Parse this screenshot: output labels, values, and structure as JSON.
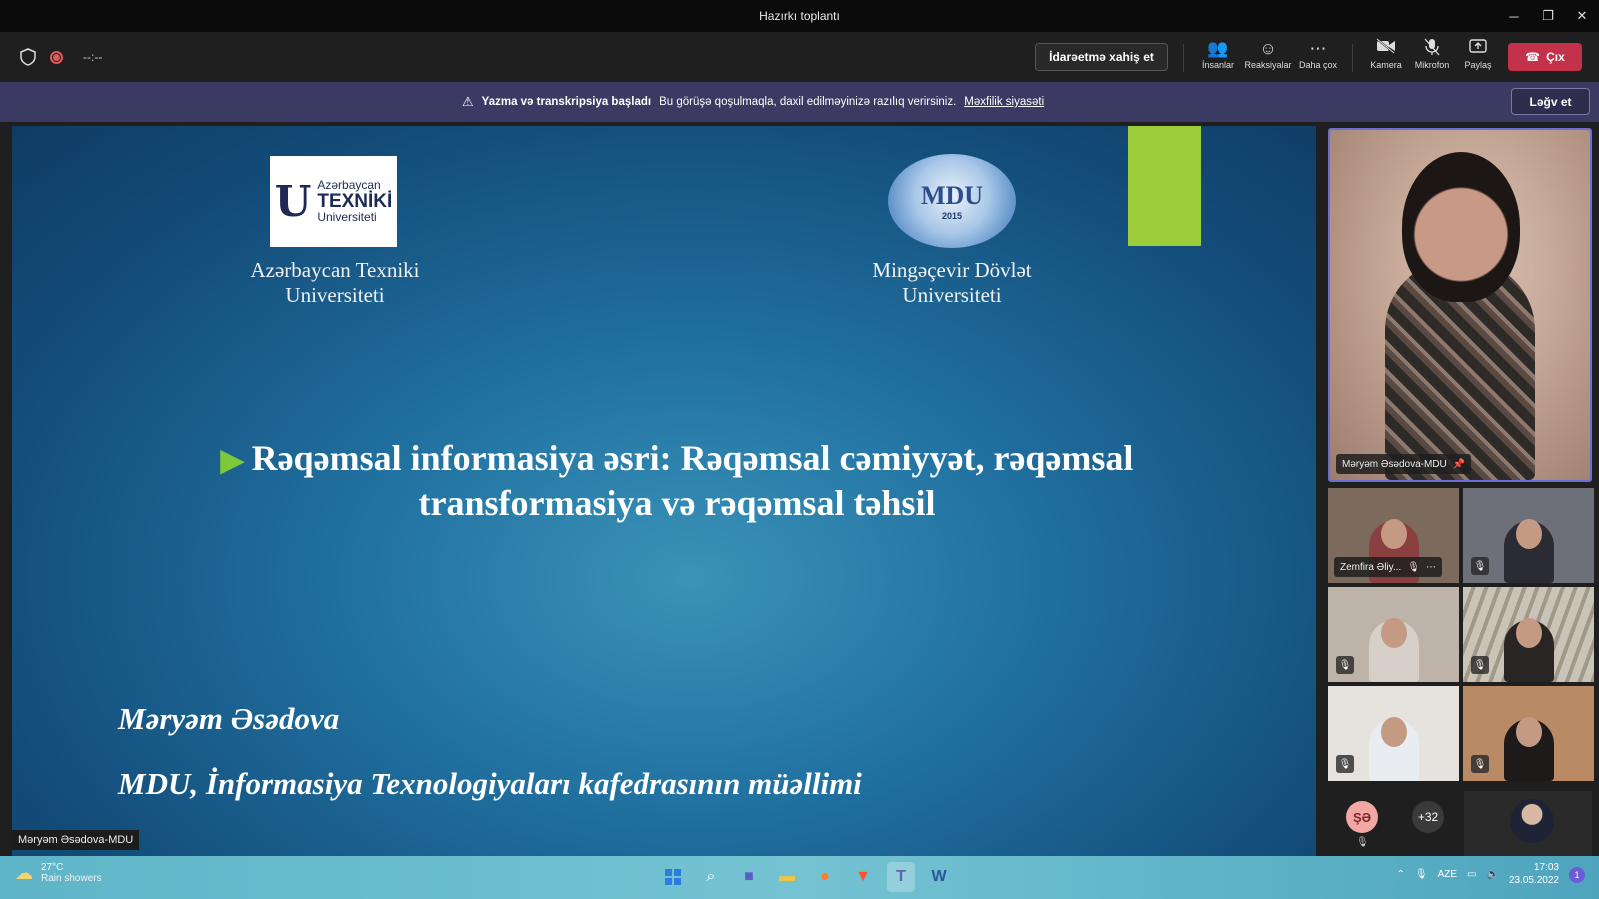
{
  "window": {
    "title": "Hazırkı toplantı",
    "controls": [
      "─",
      "❐",
      "✕"
    ]
  },
  "toolbar": {
    "timer": "--:--",
    "request_control": "İdarəetmə xahiş et",
    "people": "İnsanlar",
    "reactions": "Reaksiyalar",
    "more": "Daha çox",
    "camera": "Kamera",
    "mic": "Mikrofon",
    "share": "Paylaş",
    "leave": "Çıx"
  },
  "banner": {
    "title": "Yazma və transkripsiya başladı",
    "text": "Bu görüşə qoşulmaqla, daxil edilməyinizə razılıq verirsiniz.",
    "link": "Məxfilik siyasəti",
    "cancel": "Ləğv et"
  },
  "slide": {
    "logo_left": {
      "line1": "Azərbaycan",
      "line2": "TEXNİKİ",
      "line3": "Universiteti",
      "mark": "U"
    },
    "uni_left": {
      "line1": "Azərbaycan Texniki",
      "line2": "Universiteti"
    },
    "logo_right": {
      "text": "MDU",
      "year": "2015"
    },
    "uni_right": {
      "line1": "Mingəçevir Dövlət",
      "line2": "Universiteti"
    },
    "title_line1": "Rəqəmsal informasiya əsri: Rəqəmsal cəmiyyət, rəqəmsal",
    "title_line2": "transformasiya və rəqəmsal təhsil",
    "author": "Məryəm Əsədova",
    "department": "MDU, İnformasiya Texnologiyaları kafedrasının müəllimi"
  },
  "presenter_label": "Məryəm Əsədova-MDU",
  "main_tile": {
    "name": "Məryəm Əsədova-MDU"
  },
  "tiles": {
    "t1_name": "Zemfira Əliy..."
  },
  "roster": {
    "avatar_initials": "ŞƏ",
    "more_count": "+32"
  },
  "taskbar": {
    "temp": "27°C",
    "weather": "Rain showers",
    "lang": "AZE",
    "time": "17:03",
    "date": "23.05.2022",
    "notif_count": "1"
  }
}
